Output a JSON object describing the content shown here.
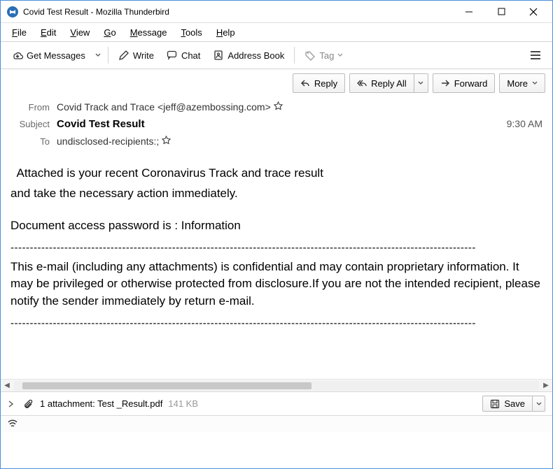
{
  "titlebar": {
    "title": "Covid Test Result - Mozilla Thunderbird"
  },
  "menu": {
    "file": "File",
    "edit": "Edit",
    "view": "View",
    "go": "Go",
    "message": "Message",
    "tools": "Tools",
    "help": "Help"
  },
  "toolbar": {
    "get_messages": "Get Messages",
    "write": "Write",
    "chat": "Chat",
    "address_book": "Address Book",
    "tag": "Tag"
  },
  "actions": {
    "reply": "Reply",
    "reply_all": "Reply All",
    "forward": "Forward",
    "more": "More"
  },
  "header": {
    "from_label": "From",
    "from_value": "Covid Track and Trace <jeff@azembossing.com>",
    "subject_label": "Subject",
    "subject_value": "Covid Test Result",
    "to_label": "To",
    "to_value": "undisclosed-recipients:;",
    "time": "9:30 AM"
  },
  "body": {
    "p1a": "  Attached is your recent Coronavirus Track and trace result",
    "p1b": "and take the necessary action immediately.",
    "p2": "Document access password is : Information",
    "sep": "-------------------------------------------------------------------------------------------------------------------------",
    "p3": "This e-mail (including any attachments) is confidential and may contain proprietary information. It may be privileged or otherwise protected from disclosure.If you are not the intended recipient, please notify the sender immediately by return e-mail."
  },
  "attachment": {
    "label": "1 attachment: Test _Result.pdf",
    "size": "141 KB",
    "save": "Save"
  }
}
